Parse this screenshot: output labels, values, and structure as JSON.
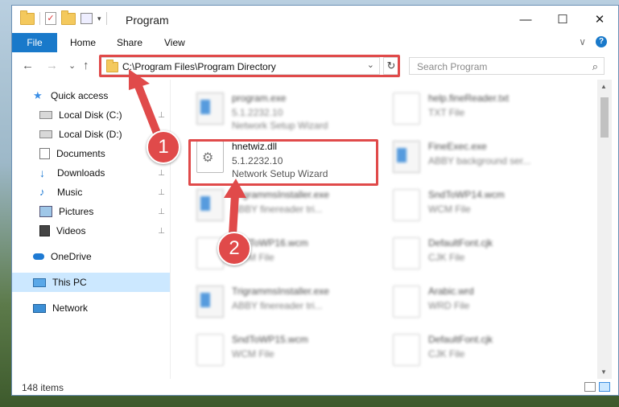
{
  "window": {
    "title": "Program",
    "controls": {
      "minimize": "—",
      "maximize": "☐",
      "close": "✕"
    }
  },
  "ribbon": {
    "tabs": [
      "File",
      "Home",
      "Share",
      "View"
    ],
    "expand": "∨",
    "help": "?"
  },
  "nav": {
    "back": "←",
    "forward": "→",
    "recent": "⌄",
    "up": "↑",
    "address": "C:\\Program Files\\Program Directory",
    "address_dropdown": "⌄",
    "refresh": "↻",
    "search_placeholder": "Search Program",
    "search_icon": "⌕"
  },
  "sidebar": {
    "items": [
      {
        "label": "Quick access",
        "icon": "star-icon",
        "pinned": false
      },
      {
        "label": "Local Disk (C:)",
        "icon": "drive-icon",
        "pinned": true
      },
      {
        "label": "Local Disk (D:)",
        "icon": "drive-icon",
        "pinned": false
      },
      {
        "label": "Documents",
        "icon": "documents-icon",
        "pinned": true
      },
      {
        "label": "Downloads",
        "icon": "download-icon",
        "pinned": true
      },
      {
        "label": "Music",
        "icon": "music-icon",
        "pinned": true
      },
      {
        "label": "Pictures",
        "icon": "pictures-icon",
        "pinned": true
      },
      {
        "label": "Videos",
        "icon": "videos-icon",
        "pinned": true
      },
      {
        "label": "OneDrive",
        "icon": "cloud-icon",
        "pinned": false
      },
      {
        "label": "This PC",
        "icon": "computer-icon",
        "pinned": false,
        "selected": true
      },
      {
        "label": "Network",
        "icon": "network-icon",
        "pinned": false
      }
    ],
    "pin_glyph": "📌"
  },
  "files": [
    {
      "name": "program.exe",
      "version": "5.1.2232.10",
      "desc": "Network Setup Wizard",
      "icon": "app-icon",
      "highlighted": false
    },
    {
      "name": "help.fineReader.txt",
      "version": "TXT File",
      "desc": "",
      "icon": "document-icon",
      "highlighted": false
    },
    {
      "name": "hnetwiz.dll",
      "version": "5.1.2232.10",
      "desc": "Network Setup Wizard",
      "icon": "dll-gear-icon",
      "highlighted": true
    },
    {
      "name": "FineExec.exe",
      "version": "ABBY background ser...",
      "desc": "",
      "icon": "app-icon",
      "highlighted": false
    },
    {
      "name": "TrigrammsInstaller.exe",
      "version": "ABBY finereader tri...",
      "desc": "",
      "icon": "app-icon",
      "highlighted": false
    },
    {
      "name": "SndToWP14.wcm",
      "version": "WCM File",
      "desc": "",
      "icon": "document-icon",
      "highlighted": false
    },
    {
      "name": "SndToWP16.wcm",
      "version": "WCM File",
      "desc": "",
      "icon": "document-icon",
      "highlighted": false
    },
    {
      "name": "DefaultFont.cjk",
      "version": "CJK File",
      "desc": "",
      "icon": "document-icon",
      "highlighted": false
    },
    {
      "name": "TrigrammsInstaller.exe",
      "version": "ABBY finereader tri...",
      "desc": "",
      "icon": "app-icon",
      "highlighted": false
    },
    {
      "name": "Arabic.wrd",
      "version": "WRD File",
      "desc": "",
      "icon": "document-icon",
      "highlighted": false
    },
    {
      "name": "SndToWP15.wcm",
      "version": "WCM File",
      "desc": "",
      "icon": "document-icon",
      "highlighted": false
    },
    {
      "name": "DefaultFont.cjk",
      "version": "CJK File",
      "desc": "",
      "icon": "document-icon",
      "highlighted": false
    }
  ],
  "status": {
    "count": "148 items"
  },
  "annotations": {
    "step1": "1",
    "step2": "2",
    "color": "#e04a4a"
  },
  "colors": {
    "accent": "#1979ca",
    "selection": "#cce8ff"
  }
}
